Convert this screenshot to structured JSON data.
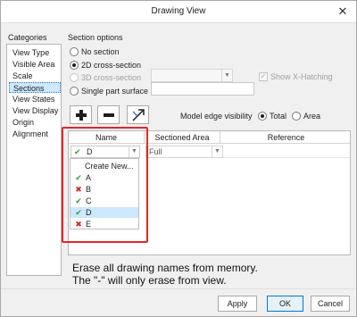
{
  "window": {
    "title": "Drawing View"
  },
  "categories": {
    "heading": "Categories",
    "items": [
      "View Type",
      "Visible Area",
      "Scale",
      "Sections",
      "View States",
      "View Display",
      "Origin",
      "Alignment"
    ],
    "selected": "Sections"
  },
  "section_options": {
    "heading": "Section options",
    "no_section": "No section",
    "cross_2d": "2D cross-section",
    "cross_3d": "3D cross-section",
    "single_part": "Single part surface",
    "show_xhatching": "Show X-Hatching"
  },
  "toolbar": {
    "add_icon": "plus-icon",
    "remove_icon": "minus-icon",
    "arrow_icon": "flip-arrow-icon"
  },
  "edge_visibility": {
    "label": "Model edge visibility",
    "total": "Total",
    "area": "Area",
    "selected": "Total"
  },
  "table": {
    "columns": [
      "Name",
      "Sectioned Area",
      "Reference"
    ],
    "row": {
      "name": "D",
      "sectioned_area": "Full"
    }
  },
  "name_dropdown": {
    "create_new": "Create New...",
    "items": [
      {
        "name": "A",
        "status": "ok"
      },
      {
        "name": "B",
        "status": "error"
      },
      {
        "name": "C",
        "status": "ok"
      },
      {
        "name": "D",
        "status": "ok"
      },
      {
        "name": "E",
        "status": "error"
      }
    ],
    "selected": "D"
  },
  "annotation": {
    "line1": "Erase all drawing names from memory.",
    "line2": "The \"-\" will only erase from view."
  },
  "buttons": {
    "apply": "Apply",
    "ok": "OK",
    "cancel": "Cancel"
  },
  "colors": {
    "accent": "#0078d7",
    "selection": "#cde8ff",
    "highlight": "#e0262b",
    "ok_mark": "#2e9e3b",
    "error_mark": "#d8262b"
  }
}
